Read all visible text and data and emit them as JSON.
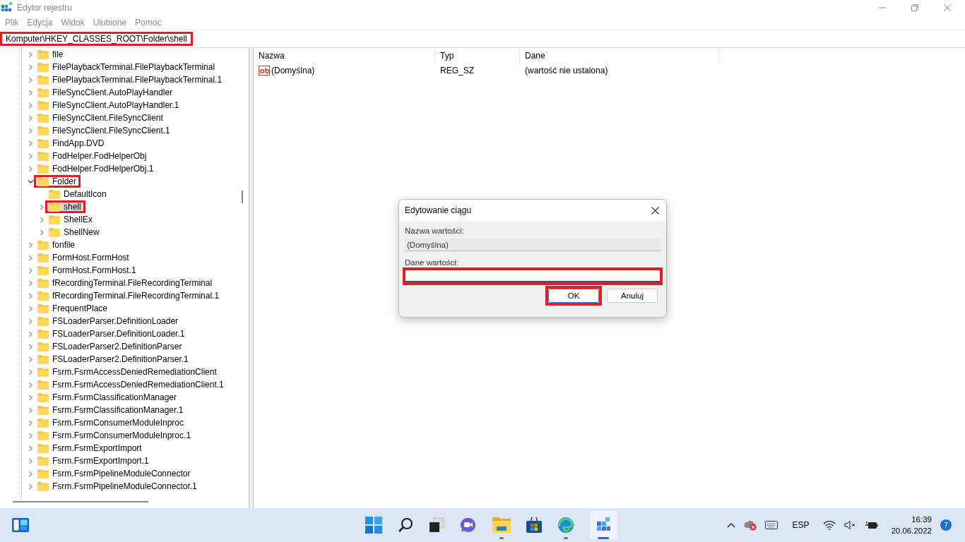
{
  "window": {
    "title": "Edytor rejestru"
  },
  "menu": [
    "Plik",
    "Edycja",
    "Widok",
    "Ulubione",
    "Pomoc"
  ],
  "address_bar": {
    "value": "Komputer\\HKEY_CLASSES_ROOT\\Folder\\shell",
    "highlighted": true
  },
  "tree": [
    {
      "label": "file",
      "has_children": true,
      "expanded": false,
      "selected": false,
      "highlighted": false
    },
    {
      "label": "FilePlaybackTerminal.FilePlaybackTerminal",
      "has_children": true,
      "expanded": false,
      "selected": false,
      "highlighted": false
    },
    {
      "label": "FilePlaybackTerminal.FilePlaybackTerminal.1",
      "has_children": true,
      "expanded": false,
      "selected": false,
      "highlighted": false
    },
    {
      "label": "FileSyncClient.AutoPlayHandler",
      "has_children": true,
      "expanded": false,
      "selected": false,
      "highlighted": false
    },
    {
      "label": "FileSyncClient.AutoPlayHandler.1",
      "has_children": true,
      "expanded": false,
      "selected": false,
      "highlighted": false
    },
    {
      "label": "FileSyncClient.FileSyncClient",
      "has_children": true,
      "expanded": false,
      "selected": false,
      "highlighted": false
    },
    {
      "label": "FileSyncClient.FileSyncClient.1",
      "has_children": true,
      "expanded": false,
      "selected": false,
      "highlighted": false
    },
    {
      "label": "FindApp.DVD",
      "has_children": true,
      "expanded": false,
      "selected": false,
      "highlighted": false
    },
    {
      "label": "FodHelper.FodHelperObj",
      "has_children": true,
      "expanded": false,
      "selected": false,
      "highlighted": false
    },
    {
      "label": "FodHelper.FodHelperObj.1",
      "has_children": true,
      "expanded": false,
      "selected": false,
      "highlighted": false
    },
    {
      "label": "Folder",
      "has_children": true,
      "expanded": true,
      "selected": false,
      "highlighted": true,
      "children": [
        {
          "label": "DefaultIcon",
          "has_children": false,
          "selected": false,
          "highlighted": false
        },
        {
          "label": "shell",
          "has_children": true,
          "expanded": false,
          "selected": true,
          "highlighted": true
        },
        {
          "label": "ShellEx",
          "has_children": true,
          "expanded": false,
          "selected": false,
          "highlighted": false
        },
        {
          "label": "ShellNew",
          "has_children": true,
          "expanded": false,
          "selected": false,
          "highlighted": false
        }
      ]
    },
    {
      "label": "fonfile",
      "has_children": true,
      "expanded": false,
      "selected": false,
      "highlighted": false
    },
    {
      "label": "FormHost.FormHost",
      "has_children": true,
      "expanded": false,
      "selected": false,
      "highlighted": false
    },
    {
      "label": "FormHost.FormHost.1",
      "has_children": true,
      "expanded": false,
      "selected": false,
      "highlighted": false
    },
    {
      "label": "fRecordingTerminal.FileRecordingTerminal",
      "has_children": true,
      "expanded": false,
      "selected": false,
      "highlighted": false
    },
    {
      "label": "fRecordingTerminal.FileRecordingTerminal.1",
      "has_children": true,
      "expanded": false,
      "selected": false,
      "highlighted": false
    },
    {
      "label": "FrequentPlace",
      "has_children": true,
      "expanded": false,
      "selected": false,
      "highlighted": false
    },
    {
      "label": "FSLoaderParser.DefinitionLoader",
      "has_children": true,
      "expanded": false,
      "selected": false,
      "highlighted": false
    },
    {
      "label": "FSLoaderParser.DefinitionLoader.1",
      "has_children": true,
      "expanded": false,
      "selected": false,
      "highlighted": false
    },
    {
      "label": "FSLoaderParser2.DefinitionParser",
      "has_children": true,
      "expanded": false,
      "selected": false,
      "highlighted": false
    },
    {
      "label": "FSLoaderParser2.DefinitionParser.1",
      "has_children": true,
      "expanded": false,
      "selected": false,
      "highlighted": false
    },
    {
      "label": "Fsrm.FsrmAccessDeniedRemediationClient",
      "has_children": true,
      "expanded": false,
      "selected": false,
      "highlighted": false
    },
    {
      "label": "Fsrm.FsrmAccessDeniedRemediationClient.1",
      "has_children": true,
      "expanded": false,
      "selected": false,
      "highlighted": false
    },
    {
      "label": "Fsrm.FsrmClassificationManager",
      "has_children": true,
      "expanded": false,
      "selected": false,
      "highlighted": false
    },
    {
      "label": "Fsrm.FsrmClassificationManager.1",
      "has_children": true,
      "expanded": false,
      "selected": false,
      "highlighted": false
    },
    {
      "label": "Fsrm.FsrmConsumerModuleInproc",
      "has_children": true,
      "expanded": false,
      "selected": false,
      "highlighted": false
    },
    {
      "label": "Fsrm.FsrmConsumerModuleInproc.1",
      "has_children": true,
      "expanded": false,
      "selected": false,
      "highlighted": false
    },
    {
      "label": "Fsrm.FsrmExportImport",
      "has_children": true,
      "expanded": false,
      "selected": false,
      "highlighted": false
    },
    {
      "label": "Fsrm.FsrmExportImport.1",
      "has_children": true,
      "expanded": false,
      "selected": false,
      "highlighted": false
    },
    {
      "label": "Fsrm.FsrmPipelineModuleConnector",
      "has_children": true,
      "expanded": false,
      "selected": false,
      "highlighted": false
    },
    {
      "label": "Fsrm.FsrmPipelineModuleConnector.1",
      "has_children": true,
      "expanded": false,
      "selected": false,
      "highlighted": false
    }
  ],
  "values_table": {
    "columns": [
      "Nazwa",
      "Typ",
      "Dane"
    ],
    "rows": [
      {
        "name": "(Domyślna)",
        "type": "REG_SZ",
        "data": "(wartość nie ustalona)"
      }
    ]
  },
  "dialog": {
    "title": "Edytowanie ciągu",
    "name_label": "Nazwa wartości:",
    "name_value": "(Domyślna)",
    "data_label": "Dane wartości:",
    "data_field_highlighted": true,
    "buttons": [
      {
        "label": "OK",
        "default": true,
        "highlighted": true
      },
      {
        "label": "Anuluj",
        "default": false,
        "highlighted": false
      }
    ]
  },
  "taskbar": {
    "tray": {
      "language": "ESP",
      "time": "16:39",
      "date": "20.06.2022",
      "notifications": "7"
    }
  }
}
